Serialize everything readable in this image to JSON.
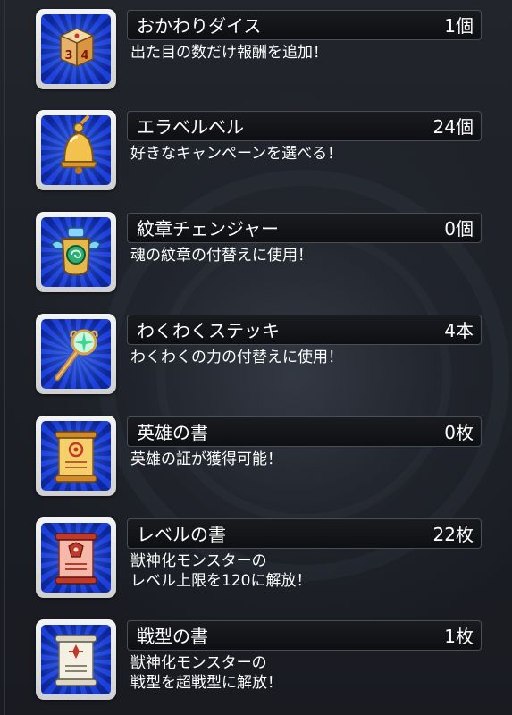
{
  "items": [
    {
      "name": "おかわりダイス",
      "count": "1個",
      "desc": "出た目の数だけ報酬を追加！",
      "icon": "dice-icon"
    },
    {
      "name": "エラベルベル",
      "count": "24個",
      "desc": "好きなキャンペーンを選べる！",
      "icon": "bell-icon"
    },
    {
      "name": "紋章チェンジャー",
      "count": "0個",
      "desc": "魂の紋章の付替えに使用！",
      "icon": "emblem-changer-icon"
    },
    {
      "name": "わくわくステッキ",
      "count": "4本",
      "desc": "わくわくの力の付替えに使用！",
      "icon": "magic-wand-icon"
    },
    {
      "name": "英雄の書",
      "count": "0枚",
      "desc": "英雄の証が獲得可能！",
      "icon": "hero-scroll-icon"
    },
    {
      "name": "レベルの書",
      "count": "22枚",
      "desc": "獣神化モンスターの\nレベル上限を120に解放！",
      "icon": "level-scroll-icon"
    },
    {
      "name": "戦型の書",
      "count": "1枚",
      "desc": "獣神化モンスターの\n戦型を超戦型に解放！",
      "icon": "battle-type-scroll-icon"
    }
  ],
  "colors": {
    "icon_bg": "#1c3fd8",
    "bar_bg": "#0e0f12",
    "text": "#ffffff"
  }
}
